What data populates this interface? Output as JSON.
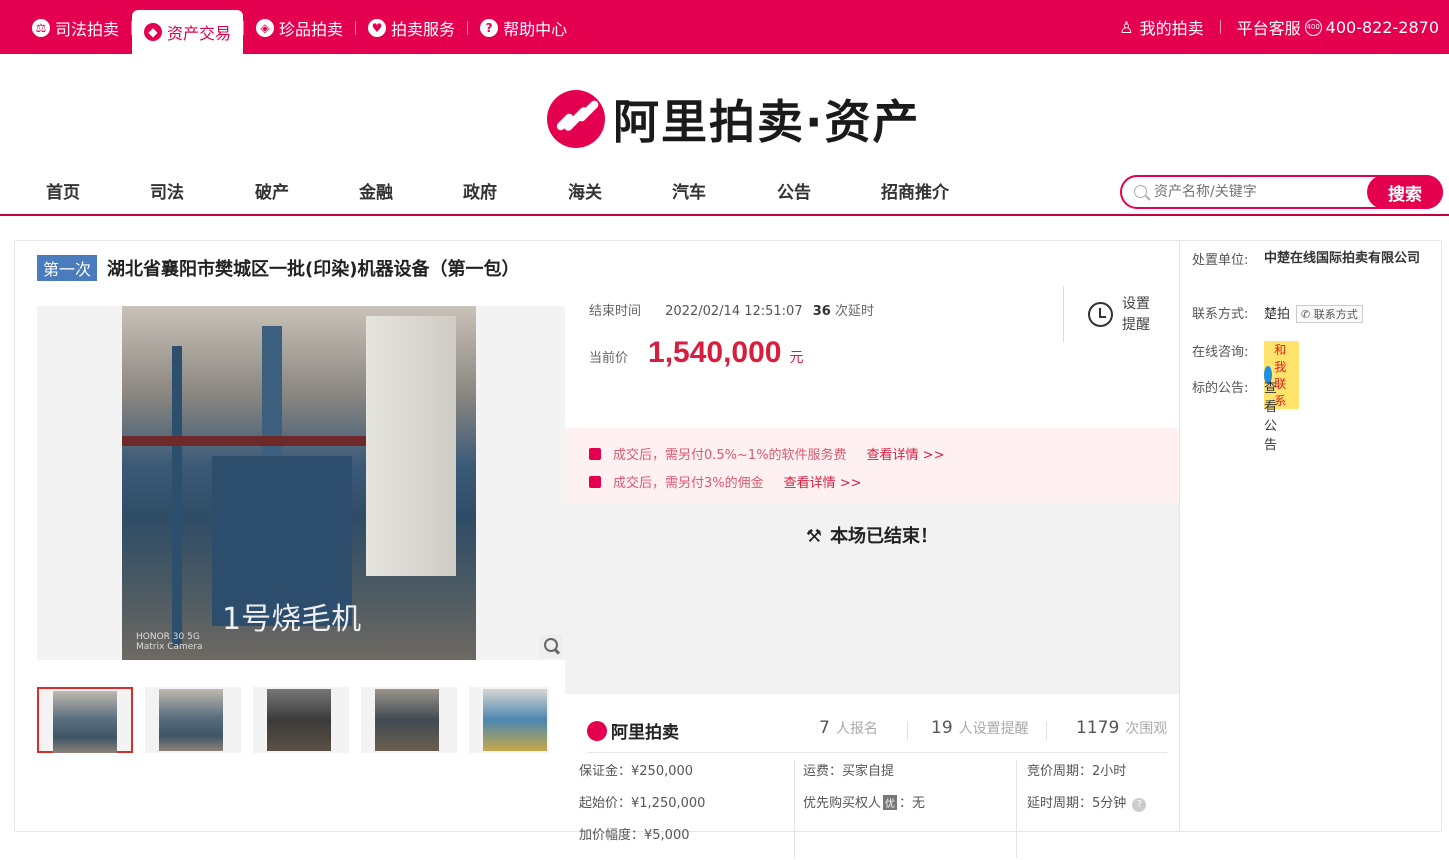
{
  "topnav": {
    "items": [
      {
        "label": "司法拍卖",
        "icon": "court-icon"
      },
      {
        "label": "资产交易",
        "icon": "asset-icon",
        "active": true
      },
      {
        "label": "珍品拍卖",
        "icon": "gem-icon"
      },
      {
        "label": "拍卖服务",
        "icon": "heart-icon"
      },
      {
        "label": "帮助中心",
        "icon": "question-icon"
      }
    ],
    "my_auction": "我的拍卖",
    "service_label": "平台客服",
    "phone": "400-822-2870"
  },
  "logo": {
    "text": "阿里拍卖·资产"
  },
  "mainnav": {
    "items": [
      "首页",
      "司法",
      "破产",
      "金融",
      "政府",
      "海关",
      "汽车",
      "公告",
      "招商推介"
    ],
    "search_placeholder": "资产名称/关键字",
    "search_button": "搜索"
  },
  "item": {
    "badge": "第一次",
    "title": "湖北省襄阳市樊城区一批(印染)机器设备（第一包）",
    "photo_caption": "1号烧毛机",
    "photo_brand_line1": "HONOR 30 5G",
    "photo_brand_line2": "Matrix Camera",
    "end_label": "结束时间",
    "end_time": "2022/02/14 12:51:07",
    "delay_count": "36",
    "delay_label": "次延时",
    "remind_line1": "设置",
    "remind_line2": "提醒",
    "price_label": "当前价",
    "price": "1,540,000",
    "unit": "元",
    "fee1": "成交后，需另付0.5%~1%的软件服务费",
    "fee2": "成交后，需另付3%的佣金",
    "fee_link": "查看详情 >>",
    "ended": "本场已结束！",
    "brand": "阿里拍卖",
    "signups": "7",
    "signups_label": "人报名",
    "reminders": "19",
    "reminders_label": "人设置提醒",
    "views": "1179",
    "views_label": "次围观",
    "deposit": "保证金：¥250,000",
    "start_price": "起始价：¥1,250,000",
    "increment": "加价幅度：¥5,000",
    "freight": "运费：买家自提",
    "priority_prefix": "优先购买权人",
    "priority_tag": "优",
    "priority_value": "：无",
    "bid_cycle": "竞价周期：2小时",
    "delay_cycle": "延时周期：5分钟"
  },
  "side": {
    "unit_label": "处置单位:",
    "unit_value": "中楚在线国际拍卖有限公司",
    "contact_label": "联系方式:",
    "contact_value": "楚拍",
    "contact_btn": "联系方式",
    "consult_label": "在线咨询:",
    "consult_value": "和我联系",
    "notice_label": "标的公告:",
    "notice_link": "查看公告"
  },
  "colors": {
    "brand": "#e5004f",
    "price": "#d71e3f",
    "badge": "#4a7bbd",
    "link": "#2e6fd1"
  }
}
